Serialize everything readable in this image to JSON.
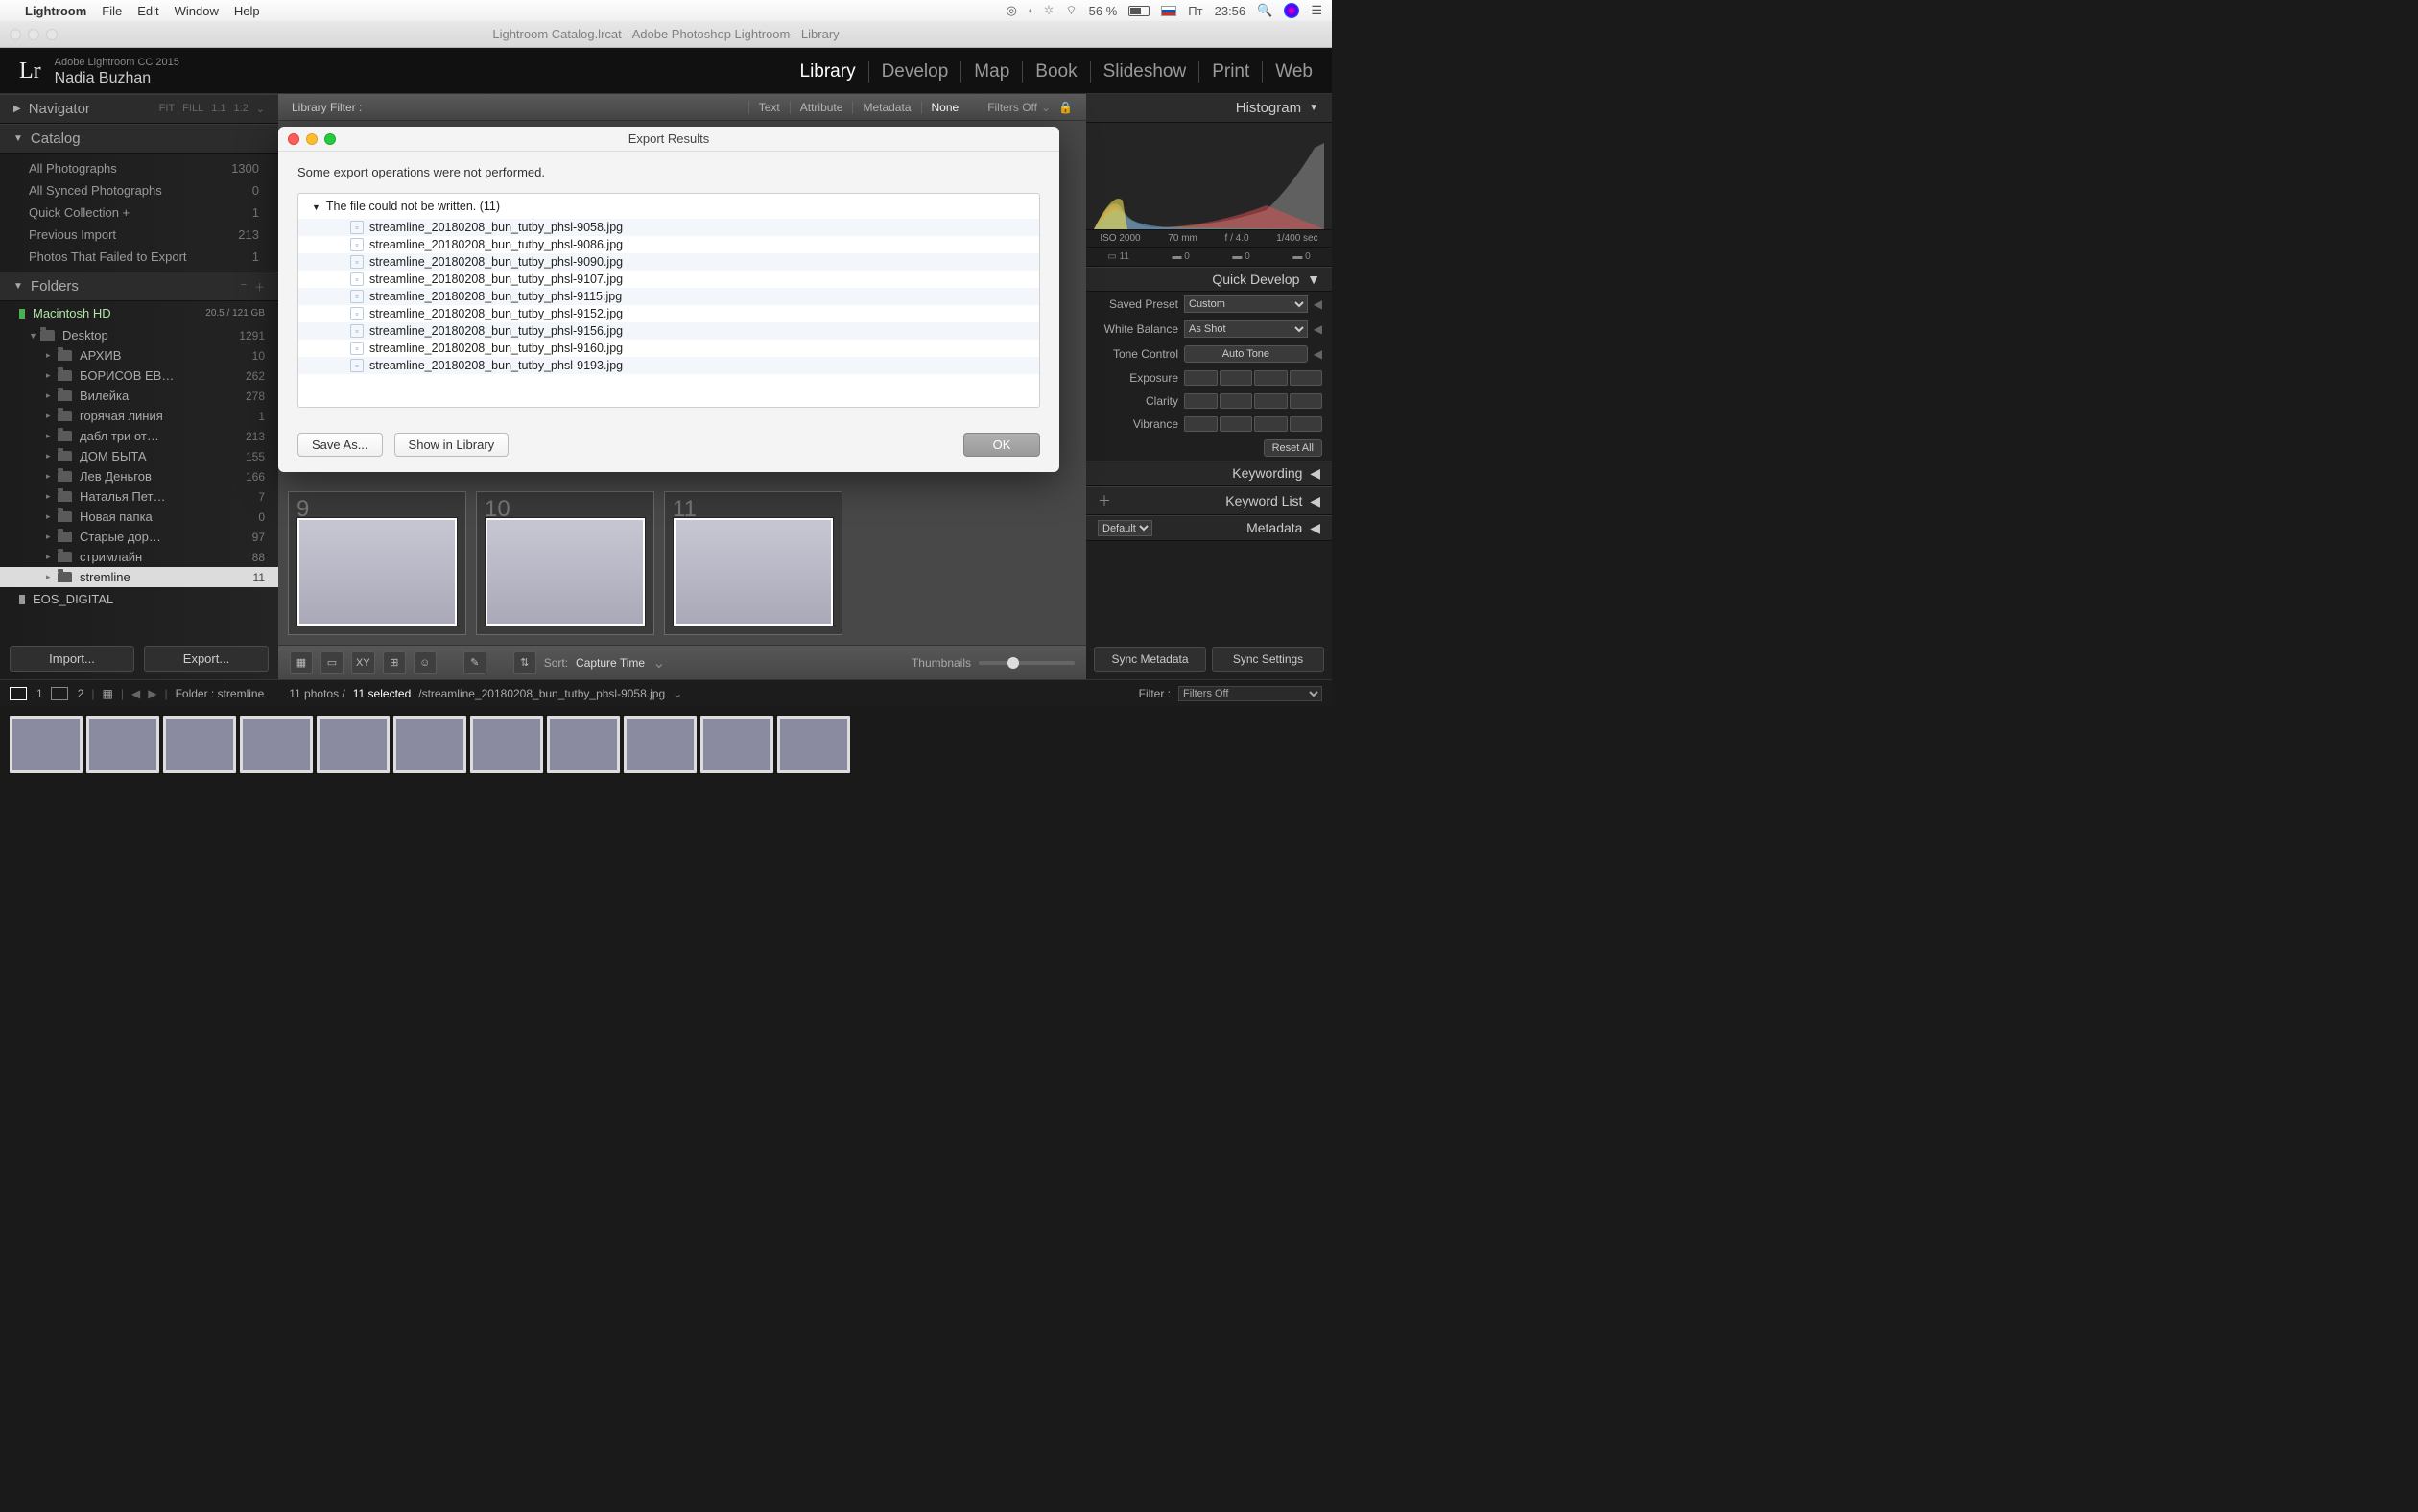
{
  "mac_menu": {
    "app": "Lightroom",
    "items": [
      "File",
      "Edit",
      "Window",
      "Help"
    ],
    "battery": "56 %",
    "day": "Пт",
    "time": "23:56"
  },
  "window_title": "Lightroom Catalog.lrcat - Adobe Photoshop Lightroom - Library",
  "identity": {
    "product": "Adobe Lightroom CC 2015",
    "user": "Nadia Buzhan",
    "logo": "Lr"
  },
  "modules": [
    "Library",
    "Develop",
    "Map",
    "Book",
    "Slideshow",
    "Print",
    "Web"
  ],
  "active_module": "Library",
  "navigator": {
    "label": "Navigator",
    "fit": "FIT",
    "fill": "FILL",
    "r1": "1:1",
    "r2": "1:2"
  },
  "catalog": {
    "label": "Catalog",
    "items": [
      {
        "name": "All Photographs",
        "count": "1300"
      },
      {
        "name": "All Synced Photographs",
        "count": "0"
      },
      {
        "name": "Quick Collection  +",
        "count": "1"
      },
      {
        "name": "Previous Import",
        "count": "213"
      },
      {
        "name": "Photos That Failed to Export",
        "count": "1"
      }
    ]
  },
  "folders": {
    "label": "Folders",
    "volume": {
      "name": "Macintosh HD",
      "usage": "20.5 / 121 GB"
    },
    "desktop": {
      "name": "Desktop",
      "count": "1291"
    },
    "items": [
      {
        "name": "АРХИВ",
        "count": "10"
      },
      {
        "name": "БОРИСОВ ЕВ…",
        "count": "262"
      },
      {
        "name": "Вилейка",
        "count": "278"
      },
      {
        "name": "горячая линия",
        "count": "1"
      },
      {
        "name": "дабл три от…",
        "count": "213"
      },
      {
        "name": "ДОМ БЫТА",
        "count": "155"
      },
      {
        "name": "Лев Деньгов",
        "count": "166"
      },
      {
        "name": "Наталья Пет…",
        "count": "7"
      },
      {
        "name": "Новая папка",
        "count": "0"
      },
      {
        "name": "Старые дор…",
        "count": "97"
      },
      {
        "name": "стримлайн",
        "count": "88"
      },
      {
        "name": "stremline",
        "count": "11",
        "selected": true
      }
    ],
    "volume2": "EOS_DIGITAL",
    "import": "Import...",
    "export": "Export..."
  },
  "filter": {
    "label": "Library Filter :",
    "tabs": [
      "Text",
      "Attribute",
      "Metadata",
      "None"
    ],
    "active": "None",
    "off": "Filters Off"
  },
  "modal": {
    "title": "Export Results",
    "message": "Some export operations were not performed.",
    "group": "The file could not be written. (11)",
    "files": [
      "streamline_20180208_bun_tutby_phsl-9058.jpg",
      "streamline_20180208_bun_tutby_phsl-9086.jpg",
      "streamline_20180208_bun_tutby_phsl-9090.jpg",
      "streamline_20180208_bun_tutby_phsl-9107.jpg",
      "streamline_20180208_bun_tutby_phsl-9115.jpg",
      "streamline_20180208_bun_tutby_phsl-9152.jpg",
      "streamline_20180208_bun_tutby_phsl-9156.jpg",
      "streamline_20180208_bun_tutby_phsl-9160.jpg",
      "streamline_20180208_bun_tutby_phsl-9193.jpg"
    ],
    "save_as": "Save As...",
    "show_lib": "Show in Library",
    "ok": "OK"
  },
  "grid": {
    "cells": [
      {
        "n": "9"
      },
      {
        "n": "10"
      },
      {
        "n": "11"
      }
    ]
  },
  "bottom_toolbar": {
    "sort_label": "Sort:",
    "sort_value": "Capture Time",
    "thumbs_label": "Thumbnails"
  },
  "right": {
    "histogram_label": "Histogram",
    "iso": "ISO 2000",
    "focal": "70 mm",
    "ap": "f / 4.0",
    "sh": "1/400 sec",
    "sel_count": "11",
    "zero1": "0",
    "zero2": "0",
    "zero3": "0",
    "qd_label": "Quick Develop",
    "saved_preset": "Saved Preset",
    "custom": "Custom",
    "wb": "White Balance",
    "as_shot": "As Shot",
    "tone": "Tone Control",
    "auto_tone": "Auto Tone",
    "exposure": "Exposure",
    "clarity": "Clarity",
    "vibrance": "Vibrance",
    "reset": "Reset All",
    "keywording": "Keywording",
    "keyword_list": "Keyword List",
    "metadata": "Metadata",
    "default": "Default",
    "sync_meta": "Sync Metadata",
    "sync_set": "Sync Settings"
  },
  "fs": {
    "label1": "1",
    "label2": "2",
    "path": "Folder : stremline",
    "count": "11 photos /",
    "selected": "11 selected",
    "file": "/streamline_20180208_bun_tutby_phsl-9058.jpg",
    "filter": "Filter :",
    "filters_off": "Filters Off"
  }
}
